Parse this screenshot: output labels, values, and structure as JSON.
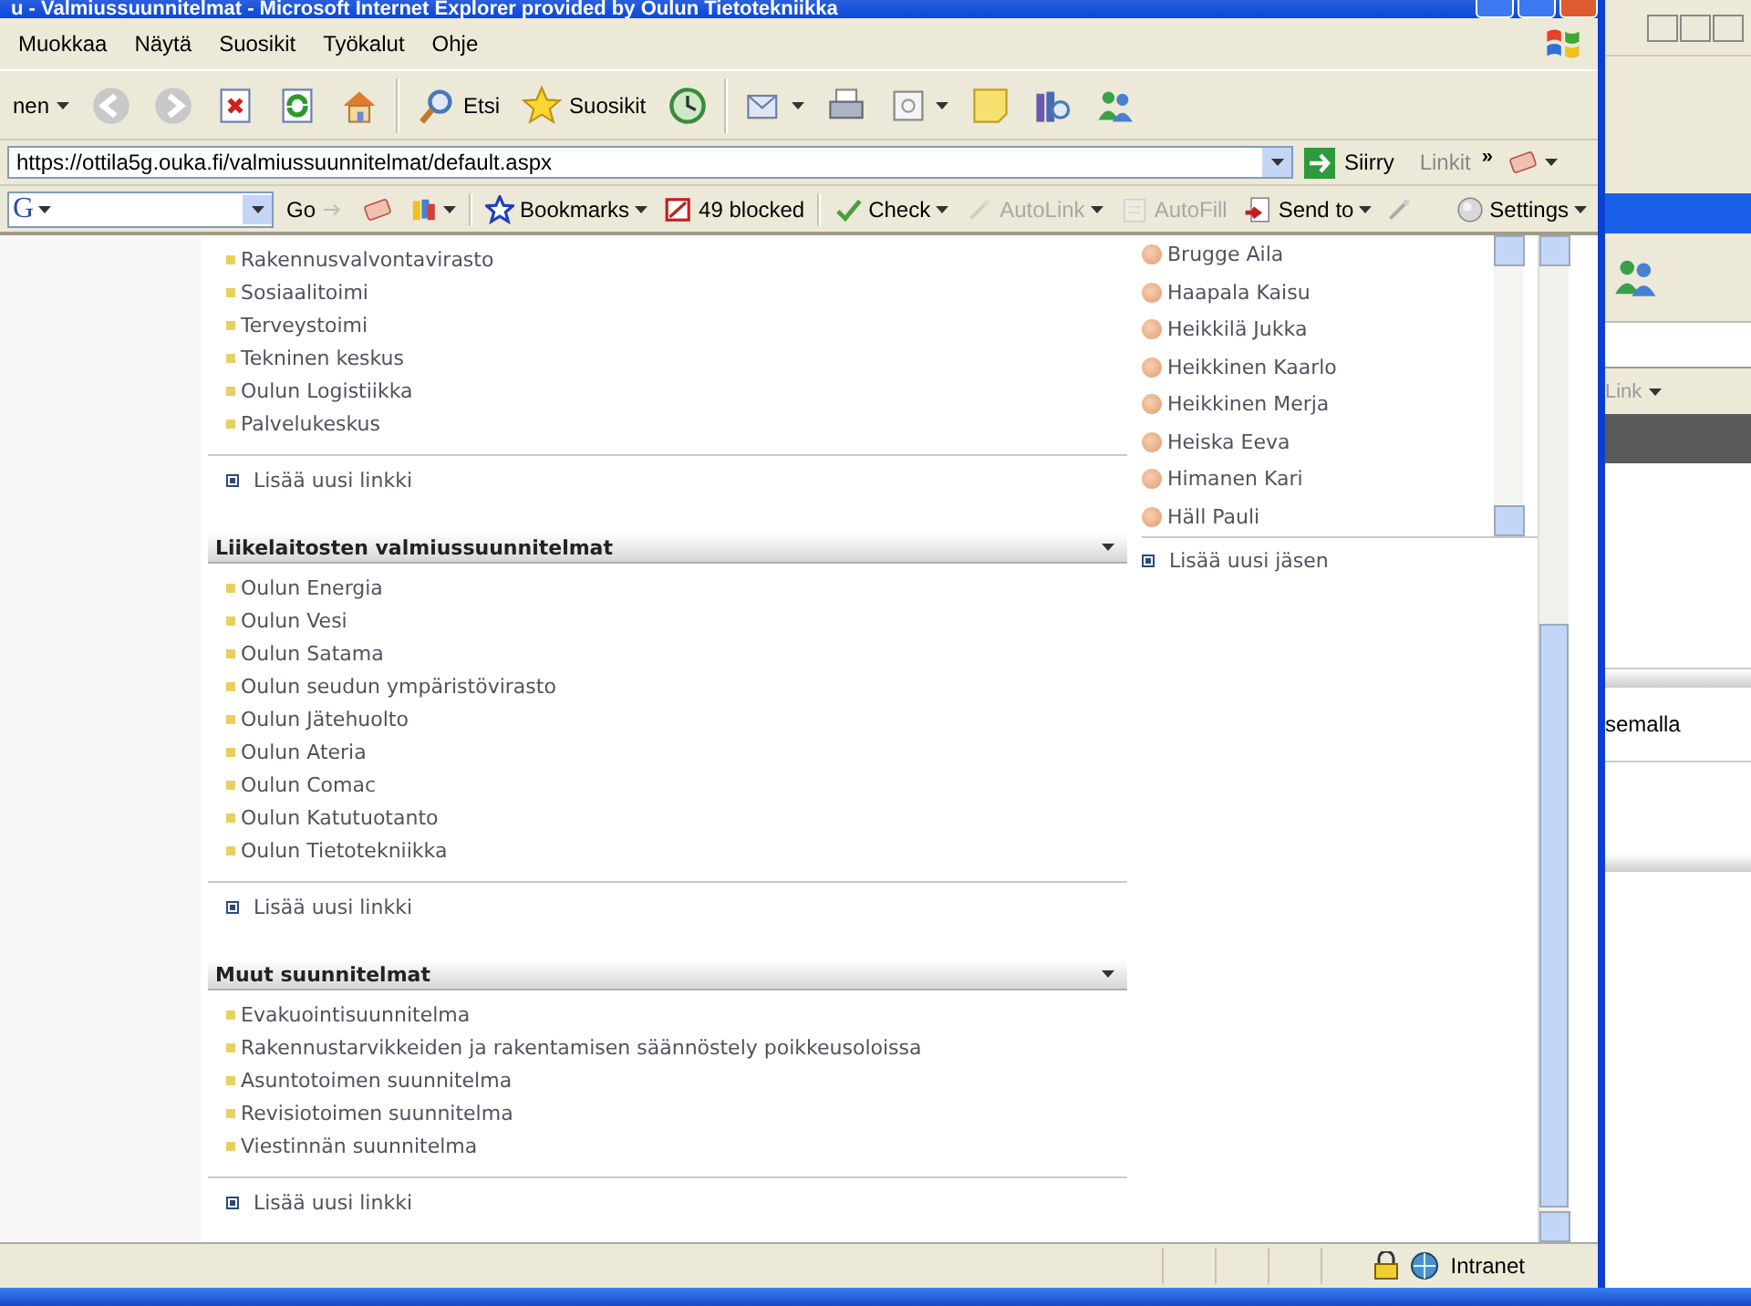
{
  "window": {
    "title": "u - Valmiussuunnitelmat - Microsoft Internet Explorer provided by Oulun Tietotekniikka"
  },
  "menu": [
    "Muokkaa",
    "Näytä",
    "Suosikit",
    "Työkalut",
    "Ohje"
  ],
  "toolbar": [
    {
      "kind": "back",
      "label": "nen"
    },
    {
      "kind": "forward"
    },
    {
      "kind": "stop"
    },
    {
      "kind": "refresh"
    },
    {
      "kind": "home"
    },
    {
      "kind": "search",
      "label": "Etsi"
    },
    {
      "kind": "favorites",
      "label": "Suosikit"
    },
    {
      "kind": "history"
    },
    {
      "kind": "mail"
    },
    {
      "kind": "print"
    },
    {
      "kind": "edit"
    },
    {
      "kind": "note"
    },
    {
      "kind": "research"
    },
    {
      "kind": "messenger"
    }
  ],
  "address_bar": {
    "url": "https://ottila5g.ouka.fi/valmiussuunnitelmat/default.aspx",
    "go_label": "Siirry",
    "links_label": "Linkit",
    "more": "»"
  },
  "google_toolbar": {
    "logo": "G",
    "items": [
      {
        "kind": "go",
        "label": "Go",
        "disabled": false
      },
      {
        "kind": "pagerank",
        "disabled": false
      },
      {
        "kind": "highlighter",
        "disabled": false
      },
      {
        "kind": "bookmarks",
        "label": "Bookmarks",
        "disabled": false
      },
      {
        "kind": "blocked",
        "label": "49 blocked",
        "disabled": false
      },
      {
        "kind": "check",
        "label": "Check",
        "disabled": false
      },
      {
        "kind": "autolink",
        "label": "AutoLink",
        "disabled": true
      },
      {
        "kind": "autofill",
        "label": "AutoFill",
        "disabled": true
      },
      {
        "kind": "sendto",
        "label": "Send to",
        "disabled": false
      },
      {
        "kind": "settings",
        "label": "Settings",
        "disabled": false
      }
    ]
  },
  "sections": [
    {
      "items": [
        "Rakennusvalvontavirasto",
        "Sosiaalitoimi",
        "Terveystoimi",
        "Tekninen keskus",
        "Oulun Logistiikka",
        "Palvelukeskus"
      ],
      "add_link": "Lisää uusi linkki"
    },
    {
      "title": "Liikelaitosten valmiussuunnitelmat",
      "items": [
        "Oulun Energia",
        "Oulun Vesi",
        "Oulun Satama",
        "Oulun seudun ympäristövirasto",
        "Oulun Jätehuolto",
        "Oulun Ateria",
        "Oulun Comac",
        "Oulun Katutuotanto",
        "Oulun Tietotekniikka"
      ],
      "add_link": "Lisää uusi linkki"
    },
    {
      "title": "Muut suunnitelmat",
      "items": [
        "Evakuointisuunnitelma",
        "Rakennustarvikkeiden ja rakentamisen säännöstely poikkeusoloissa",
        "Asuntotoimen suunnitelma",
        "Revisiotoimen suunnitelma",
        "Viestinnän suunnitelma"
      ],
      "add_link": "Lisää uusi linkki"
    }
  ],
  "members": {
    "items": [
      "Brugge Aila",
      "Haapala Kaisu",
      "Heikkilä Jukka",
      "Heikkinen Kaarlo",
      "Heikkinen Merja",
      "Heiska Eeva",
      "Himanen Kari",
      "Häll Pauli"
    ],
    "add_link": "Lisää uusi jäsen"
  },
  "status_bar": {
    "zone": "Intranet"
  },
  "background_window": {
    "link_text": "Link",
    "text": "semalla"
  }
}
